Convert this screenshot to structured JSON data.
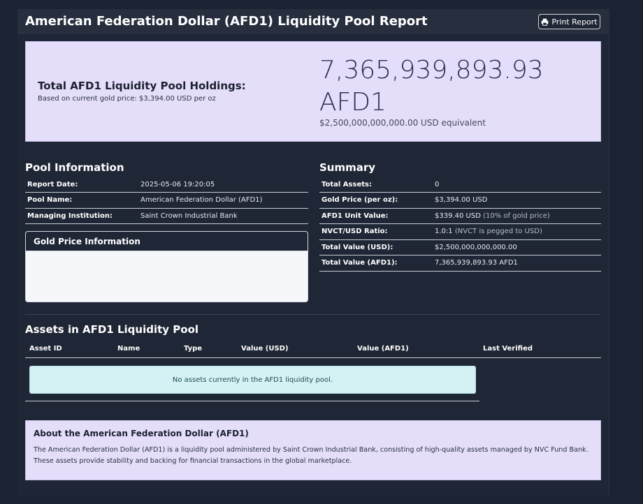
{
  "header": {
    "title": "American Federation Dollar (AFD1) Liquidity Pool Report",
    "print_label": "Print Report"
  },
  "holdings": {
    "label": "Total AFD1 Liquidity Pool Holdings:",
    "subtext": "Based on current gold price: $3,394.00 USD per oz",
    "amount": "7,365,939,893.93 AFD1",
    "usd_equivalent": "$2,500,000,000,000.00 USD equivalent"
  },
  "pool_info": {
    "title": "Pool Information",
    "rows": [
      {
        "key": "Report Date:",
        "value": "2025-05-06 19:20:05"
      },
      {
        "key": "Pool Name:",
        "value": "American Federation Dollar (AFD1)"
      },
      {
        "key": "Managing Institution:",
        "value": "Saint Crown Industrial Bank"
      }
    ]
  },
  "gold_card": {
    "title": "Gold Price Information"
  },
  "summary": {
    "title": "Summary",
    "rows": [
      {
        "key": "Total Assets:",
        "value": "0",
        "note": ""
      },
      {
        "key": "Gold Price (per oz):",
        "value": "$3,394.00 USD",
        "note": ""
      },
      {
        "key": "AFD1 Unit Value:",
        "value": "$339.40 USD",
        "note": "(10% of gold price)"
      },
      {
        "key": "NVCT/USD Ratio:",
        "value": "1.0:1",
        "note": "(NVCT is pegged to USD)"
      },
      {
        "key": "Total Value (USD):",
        "value": "$2,500,000,000,000.00",
        "note": ""
      },
      {
        "key": "Total Value (AFD1):",
        "value": "7,365,939,893.93 AFD1",
        "note": ""
      }
    ]
  },
  "assets": {
    "title": "Assets in AFD1 Liquidity Pool",
    "columns": [
      "Asset ID",
      "Name",
      "Type",
      "Value (USD)",
      "Value (AFD1)",
      "Last Verified"
    ],
    "empty_message": "No assets currently in the AFD1 liquidity pool."
  },
  "about": {
    "title": "About the American Federation Dollar (AFD1)",
    "text": "The American Federation Dollar (AFD1) is a liquidity pool administered by Saint Crown Industrial Bank, consisting of high-quality assets managed by NVC Fund Bank. These assets provide stability and backing for financial transactions in the global marketplace."
  },
  "icons": {
    "print": "printer-icon"
  }
}
